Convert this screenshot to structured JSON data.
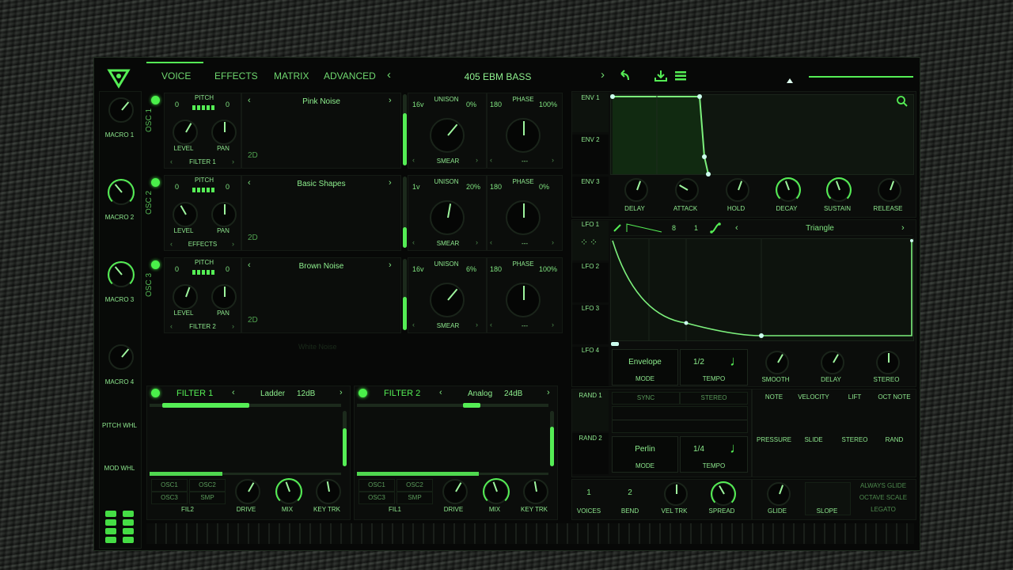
{
  "colors": {
    "accent": "#55ee55",
    "panel": "#0b0d0b",
    "bg": "#070807"
  },
  "tabs": [
    "VOICE",
    "EFFECTS",
    "MATRIX",
    "ADVANCED"
  ],
  "preset": {
    "name": "405 EBM BASS",
    "prev": "‹",
    "next": "›"
  },
  "macros": [
    "MACRO 1",
    "MACRO 2",
    "MACRO 3",
    "MACRO 4",
    "PITCH WHL",
    "MOD WHL"
  ],
  "osc": [
    {
      "label": "OSC 1",
      "pitch_label": "PITCH",
      "pitch_left": "0",
      "pitch_right": "0",
      "level": "LEVEL",
      "pan": "PAN",
      "dest": "FILTER 1",
      "wave": "Pink Noise",
      "mode": "2D",
      "unison_voices": "16v",
      "unison_label": "UNISON",
      "unison_pct": "0%",
      "phase_val": "180",
      "phase_label": "PHASE",
      "phase_pct": "100%",
      "smear": "SMEAR",
      "dash": "---"
    },
    {
      "label": "OSC 2",
      "pitch_label": "PITCH",
      "pitch_left": "0",
      "pitch_right": "0",
      "level": "LEVEL",
      "pan": "PAN",
      "dest": "EFFECTS",
      "wave": "Basic Shapes",
      "mode": "2D",
      "unison_voices": "1v",
      "unison_label": "UNISON",
      "unison_pct": "20%",
      "phase_val": "180",
      "phase_label": "PHASE",
      "phase_pct": "0%",
      "smear": "SMEAR",
      "dash": "---"
    },
    {
      "label": "OSC 3",
      "pitch_label": "PITCH",
      "pitch_left": "0",
      "pitch_right": "0",
      "level": "LEVEL",
      "pan": "PAN",
      "dest": "FILTER 2",
      "wave": "Brown Noise",
      "mode": "2D",
      "unison_voices": "16v",
      "unison_label": "UNISON",
      "unison_pct": "6%",
      "phase_val": "180",
      "phase_label": "PHASE",
      "phase_pct": "100%",
      "smear": "SMEAR",
      "dash": "---"
    }
  ],
  "osc4_ghost": "White Noise",
  "filters": [
    {
      "title": "FILTER 1",
      "type": "Ladder",
      "slope": "12dB",
      "routes": [
        "OSC1",
        "OSC2",
        "OSC3",
        "SMP"
      ],
      "fil": "FIL2",
      "drive": "DRIVE",
      "mix": "MIX",
      "keytrk": "KEY TRK"
    },
    {
      "title": "FILTER 2",
      "type": "Analog",
      "slope": "24dB",
      "routes": [
        "OSC1",
        "OSC2",
        "OSC3",
        "SMP"
      ],
      "fil": "FIL1",
      "drive": "DRIVE",
      "mix": "MIX",
      "keytrk": "KEY TRK"
    }
  ],
  "env": {
    "tabs": [
      "ENV 1",
      "ENV 2",
      "ENV 3"
    ],
    "knobs": [
      "DELAY",
      "ATTACK",
      "HOLD",
      "DECAY",
      "SUSTAIN",
      "RELEASE"
    ]
  },
  "lfo": {
    "tabs": [
      "LFO 1",
      "LFO 2",
      "LFO 3",
      "LFO 4"
    ],
    "grid_a": "8",
    "grid_b": "1",
    "shape": "Triangle",
    "mode_val": "Envelope",
    "mode_label": "MODE",
    "tempo_val": "1/2",
    "tempo_label": "TEMPO",
    "knobs": [
      "SMOOTH",
      "DELAY",
      "STEREO"
    ]
  },
  "rand": {
    "tabs": [
      "RAND 1",
      "RAND 2"
    ],
    "sync": "SYNC",
    "stereo": "STEREO",
    "mode_val": "Perlin",
    "mode_label": "MODE",
    "tempo_val": "1/4",
    "tempo_label": "TEMPO"
  },
  "mod_sources": [
    "NOTE",
    "VELOCITY",
    "LIFT",
    "OCT NOTE",
    "PRESSURE",
    "SLIDE",
    "STEREO",
    "RAND"
  ],
  "voice": {
    "voices_val": "1",
    "voices_label": "VOICES",
    "bend_val": "2",
    "bend_label": "BEND",
    "vel_trk": "VEL TRK",
    "spread": "SPREAD",
    "glide": "GLIDE",
    "slope": "SLOPE",
    "options": [
      "ALWAYS GLIDE",
      "OCTAVE SCALE",
      "LEGATO"
    ]
  }
}
